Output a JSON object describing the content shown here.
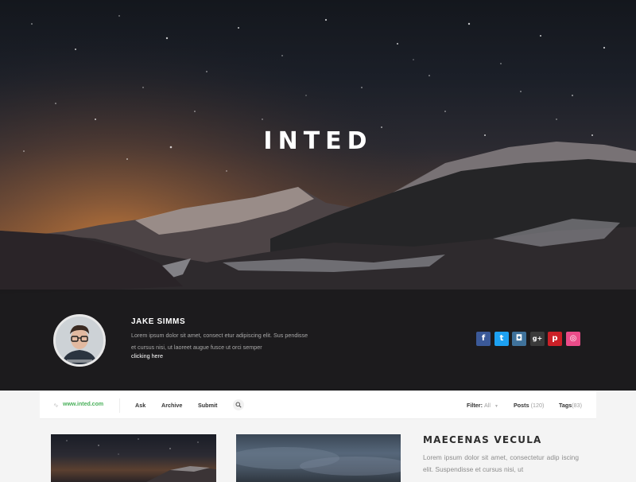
{
  "hero": {
    "title": "INTED"
  },
  "profile": {
    "name": "JAKE SIMMS",
    "bio": "Lorem ipsum dolor sit amet, consect etur adipiscing elit. Sus pendisse et cursus nisi, ut laoreet augue fusce ut orci semper",
    "link": "clicking here"
  },
  "social": [
    {
      "icon": "facebook-icon",
      "glyph": "f",
      "color": "#3b5998"
    },
    {
      "icon": "twitter-icon",
      "glyph": "t",
      "color": "#1da1f2"
    },
    {
      "icon": "instagram-icon",
      "glyph": "◘",
      "color": "#3f729b"
    },
    {
      "icon": "google-plus-icon",
      "glyph": "g+",
      "color": "#3a3a3a"
    },
    {
      "icon": "pinterest-icon",
      "glyph": "p",
      "color": "#cb2027"
    },
    {
      "icon": "dribbble-icon",
      "glyph": "◎",
      "color": "#ea4c89"
    }
  ],
  "nav": {
    "site_url": "www.inted.com",
    "items": [
      "Ask",
      "Archive",
      "Submit"
    ],
    "filter_label": "Filter:",
    "filter_value": "All",
    "posts_label": "Posts",
    "posts_count": "(120)",
    "tags_label": "Tags",
    "tags_count": "(83)"
  },
  "post": {
    "title": "MAECENAS VECULA",
    "excerpt": "Lorem ipsum dolor sit amet, consectetur adip iscing elit. Suspendisse et cursus nisi, ut"
  },
  "colors": {
    "accent_green": "#49b05a"
  }
}
